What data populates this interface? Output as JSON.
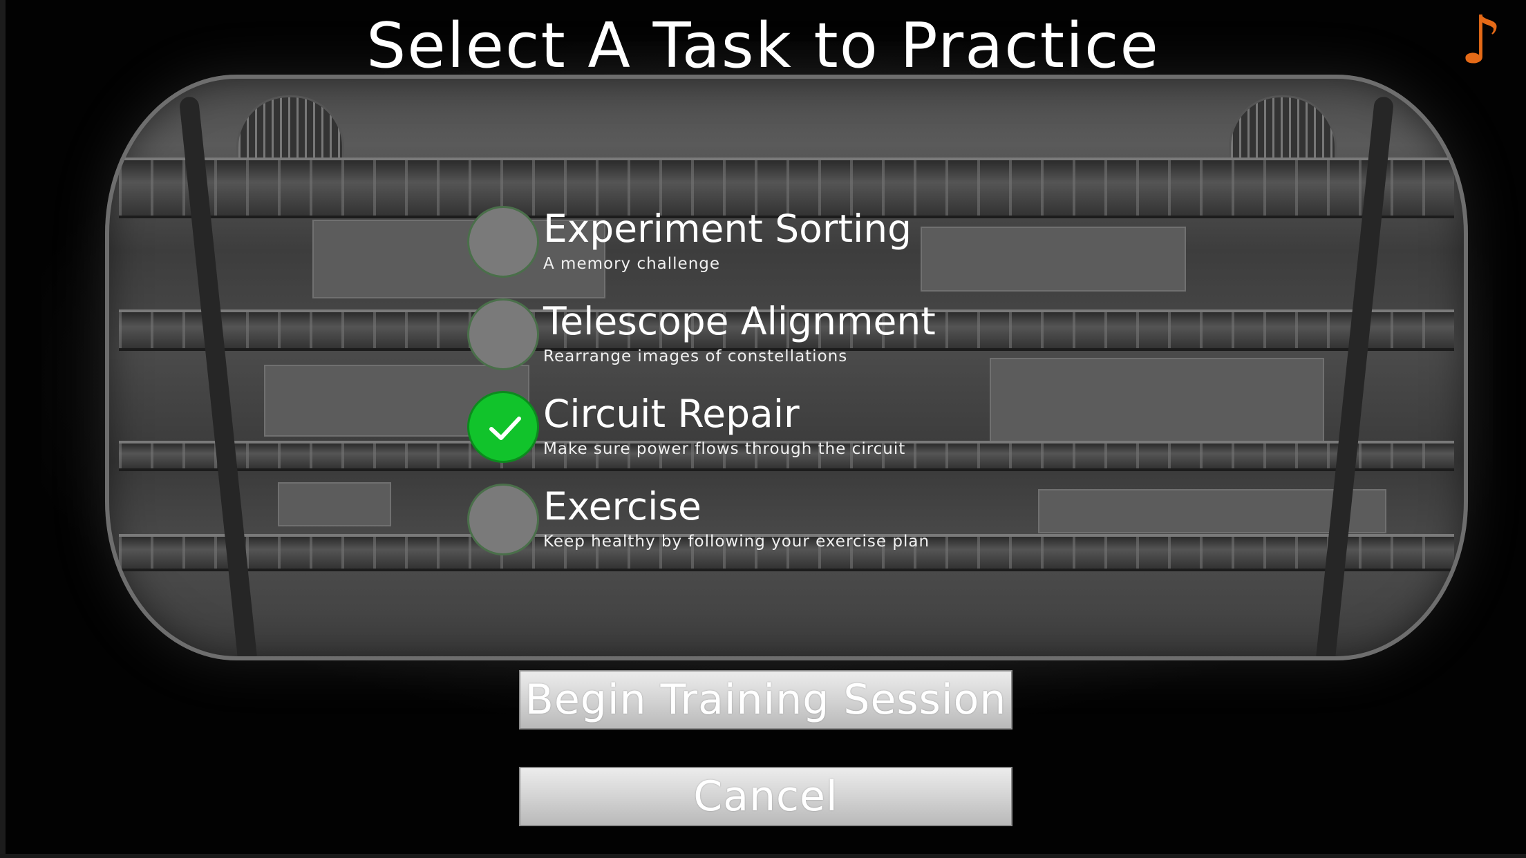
{
  "screen": {
    "title": "Select A Task to Practice"
  },
  "icons": {
    "music": "music-note-icon",
    "music_color": "#e56a17",
    "check": "checkmark-icon"
  },
  "colors": {
    "selected": "#11c32b",
    "unselected": "#7a7a7a"
  },
  "tasks": [
    {
      "name": "Experiment Sorting",
      "description": "A memory challenge",
      "selected": false
    },
    {
      "name": "Telescope Alignment",
      "description": "Rearrange images of constellations",
      "selected": false
    },
    {
      "name": "Circuit Repair",
      "description": "Make sure power flows through the circuit",
      "selected": true
    },
    {
      "name": "Exercise",
      "description": "Keep healthy by following your exercise plan",
      "selected": false
    }
  ],
  "buttons": {
    "begin_label": "Begin Training Session",
    "cancel_label": "Cancel"
  }
}
